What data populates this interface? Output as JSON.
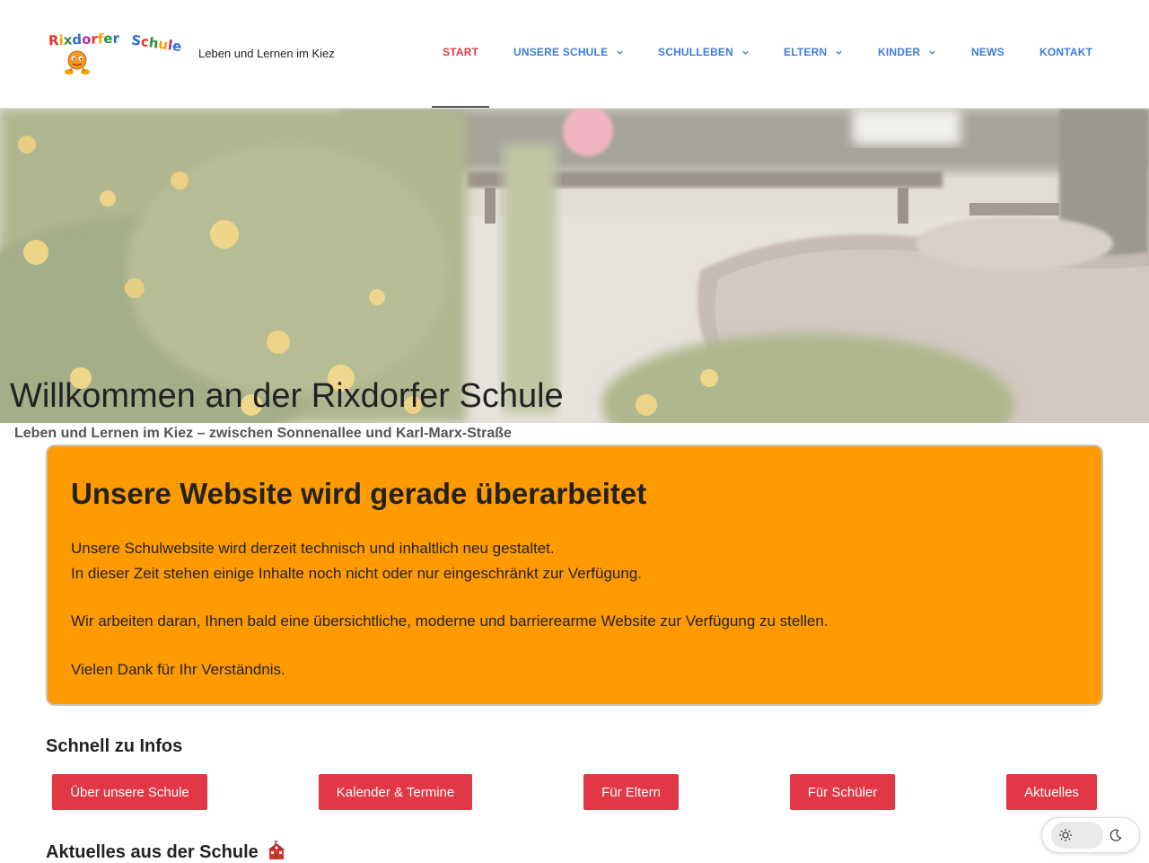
{
  "header": {
    "logo_text": "Rixdorfer Schule",
    "tagline": "Leben und Lernen im Kiez"
  },
  "nav": {
    "items": [
      {
        "label": "START",
        "active": true,
        "dropdown": false
      },
      {
        "label": "UNSERE SCHULE",
        "active": false,
        "dropdown": true
      },
      {
        "label": "SCHULLEBEN",
        "active": false,
        "dropdown": true
      },
      {
        "label": "ELTERN",
        "active": false,
        "dropdown": true
      },
      {
        "label": "KINDER",
        "active": false,
        "dropdown": true
      },
      {
        "label": "NEWS",
        "active": false,
        "dropdown": false
      },
      {
        "label": "KONTAKT",
        "active": false,
        "dropdown": false
      }
    ]
  },
  "hero": {
    "title": "Willkommen an der Rixdorfer Schule",
    "subtitle": "Leben und Lernen im Kiez – zwischen Sonnenallee und Karl-Marx-Straße"
  },
  "notice": {
    "title": "Unsere Website wird gerade überarbeitet",
    "line1": "Unsere Schulwebsite wird derzeit technisch und inhaltlich neu gestaltet.",
    "line2": "In dieser Zeit stehen einige Inhalte noch nicht oder nur eingeschränkt zur Verfügung.",
    "line3": "Wir arbeiten daran, Ihnen bald eine übersichtliche, moderne und barrierearme Website zur Verfügung zu stellen.",
    "line4": "Vielen Dank für Ihr Verständnis."
  },
  "quick_links": {
    "title": "Schnell zu Infos",
    "buttons": [
      "Über unsere Schule",
      "Kalender & Termine",
      "Für Eltern",
      "Für Schüler",
      "Aktuelles"
    ]
  },
  "news_section": {
    "title": "Aktuelles aus der Schule"
  },
  "icons": {
    "logo": "rixdorfer-schule-logo",
    "chevron": "chevron-down-icon",
    "school": "school-building-icon",
    "sun": "sun-icon",
    "moon": "moon-icon"
  },
  "colors": {
    "nav_link": "#3b7dd8",
    "nav_active": "#e03a3e",
    "notice_bg": "#ff9b00",
    "button_bg": "#e23744"
  }
}
